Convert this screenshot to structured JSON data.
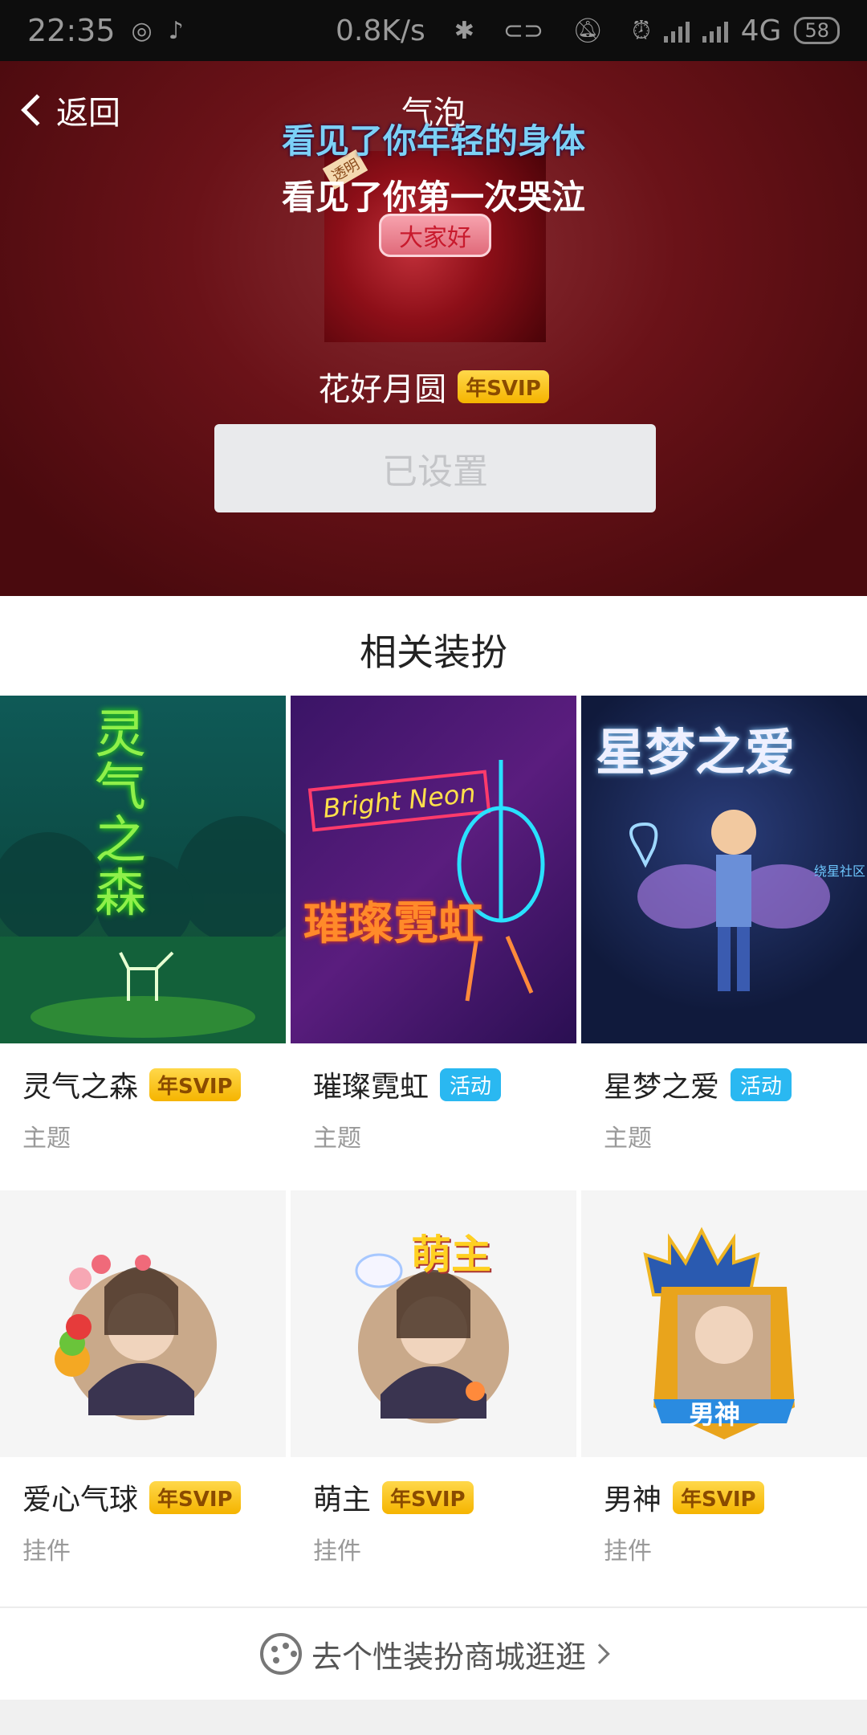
{
  "status_bar": {
    "time": "22:35",
    "net_speed": "0.8K/s",
    "network": "4G",
    "battery": "58"
  },
  "header": {
    "back_label": "返回",
    "title": "气泡"
  },
  "preview": {
    "lyric_line1": "看见了你年轻的身体",
    "lyric_line2": "看见了你第一次哭泣",
    "bubble_text": "大家好",
    "tag_text": "透明"
  },
  "current": {
    "name": "花好月圆",
    "badge": "年SVIP",
    "button_label": "已设置"
  },
  "related": {
    "title": "相关装扮",
    "items": [
      {
        "name": "灵气之森",
        "badge": "年SVIP",
        "badge_type": "svip",
        "category": "主题",
        "art_text": "灵气之森"
      },
      {
        "name": "璀璨霓虹",
        "badge": "活动",
        "badge_type": "activity",
        "category": "主题",
        "art_text": "璀璨霓虹",
        "art_sub": "Bright Neon"
      },
      {
        "name": "星梦之爱",
        "badge": "活动",
        "badge_type": "activity",
        "category": "主题",
        "art_text": "星梦之爱",
        "art_sub": "绕星社区"
      },
      {
        "name": "爱心气球",
        "badge": "年SVIP",
        "badge_type": "svip",
        "category": "挂件"
      },
      {
        "name": "萌主",
        "badge": "年SVIP",
        "badge_type": "svip",
        "category": "挂件",
        "art_text": "萌主"
      },
      {
        "name": "男神",
        "badge": "年SVIP",
        "badge_type": "svip",
        "category": "挂件",
        "art_text": "男神"
      }
    ]
  },
  "footer": {
    "link_label": "去个性装扮商城逛逛"
  },
  "colors": {
    "svip_badge": "#f5b400",
    "activity_badge": "#2ab8f1",
    "hero_bg": "#6a1218"
  }
}
